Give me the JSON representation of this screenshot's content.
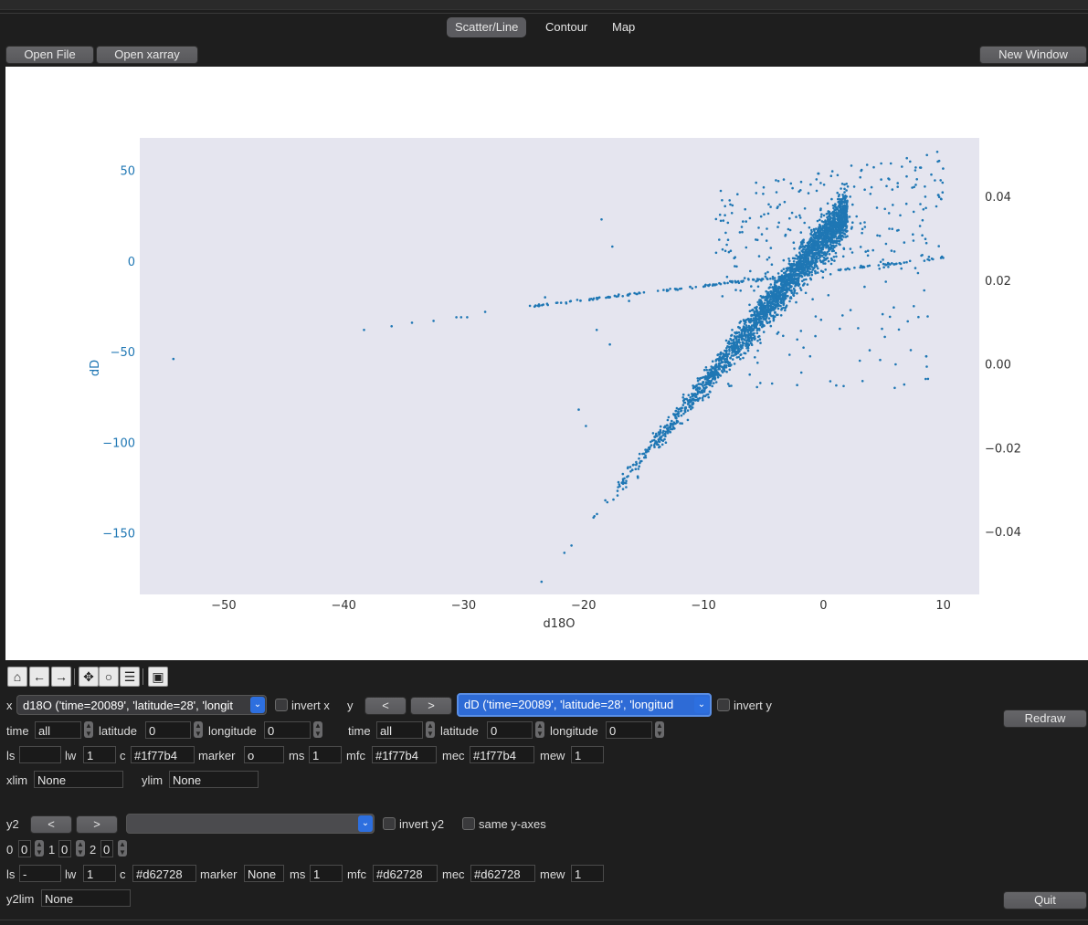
{
  "tabs": [
    {
      "label": "Scatter/Line",
      "active": true
    },
    {
      "label": "Contour",
      "active": false
    },
    {
      "label": "Map",
      "active": false
    }
  ],
  "buttons": {
    "open_file": "Open File",
    "open_xarray": "Open xarray",
    "new_window": "New Window",
    "redraw": "Redraw",
    "quit": "Quit",
    "prev": "<",
    "next": ">"
  },
  "toolbar_icons": [
    "home-icon",
    "back-arrow-icon",
    "forward-arrow-icon",
    "pan-icon",
    "zoom-icon",
    "configure-subplots-icon",
    "save-icon"
  ],
  "chart_data": {
    "type": "scatter",
    "xlabel": "d18O",
    "ylabel": "dD",
    "xlim": [
      -57,
      13
    ],
    "ylim": [
      -184,
      68
    ],
    "y2lim": [
      -0.055,
      0.054
    ],
    "x_ticks": [
      "−50",
      "−40",
      "−30",
      "−20",
      "−10",
      "0",
      "10"
    ],
    "y_ticks": [
      "50",
      "0",
      "−50",
      "−100",
      "−150"
    ],
    "y2_ticks": [
      "0.04",
      "0.02",
      "0.00",
      "−0.02",
      "−0.04"
    ],
    "series": [
      {
        "color": "#1f77b4",
        "marker": "o",
        "size": 1,
        "description_points": [
          [
            -54.2,
            -54
          ],
          [
            -38.3,
            -38
          ],
          [
            -36,
            -36
          ],
          [
            -34.3,
            -34
          ],
          [
            -32.5,
            -33
          ],
          [
            -30.6,
            -31
          ],
          [
            -30.2,
            -31
          ],
          [
            -29.7,
            -31
          ],
          [
            -28.2,
            -28
          ],
          [
            -23.5,
            -177
          ],
          [
            -23.2,
            -20
          ],
          [
            -21.6,
            -161
          ],
          [
            -21,
            -157
          ],
          [
            -20.4,
            -82
          ],
          [
            -19.8,
            -91
          ],
          [
            -18.9,
            -38
          ],
          [
            -18.5,
            23
          ],
          [
            -17.8,
            -46
          ],
          [
            -17.6,
            8
          ],
          [
            -16.2,
            -22
          ]
        ]
      },
      {
        "color": "#1f77b4",
        "marker": "o",
        "size": 1,
        "axis": "y2"
      }
    ],
    "background": "#e5e5ef",
    "grid": false
  },
  "x_controls": {
    "label": "x",
    "variable": "d18O ('time=20089', 'latitude=28', 'longit",
    "invert_label": "invert x",
    "time_label": "time",
    "time_value": "all",
    "latitude_label": "latitude",
    "latitude_value": "0",
    "longitude_label": "longitude",
    "longitude_value": "0"
  },
  "y_controls": {
    "label": "y",
    "variable": "dD ('time=20089', 'latitude=28', 'longitud",
    "invert_label": "invert y",
    "time_label": "time",
    "time_value": "all",
    "latitude_label": "latitude",
    "latitude_value": "0",
    "longitude_label": "longitude",
    "longitude_value": "0"
  },
  "style1": {
    "ls_label": "ls",
    "ls": "",
    "lw_label": "lw",
    "lw": "1",
    "c_label": "c",
    "c": "#1f77b4",
    "marker_label": "marker",
    "marker": "o",
    "ms_label": "ms",
    "ms": "1",
    "mfc_label": "mfc",
    "mfc": "#1f77b4",
    "mec_label": "mec",
    "mec": "#1f77b4",
    "mew_label": "mew",
    "mew": "1"
  },
  "limits": {
    "xlim_label": "xlim",
    "xlim": "None",
    "ylim_label": "ylim",
    "ylim": "None"
  },
  "y2_controls": {
    "label": "y2",
    "variable": "",
    "invert_label": "invert y2",
    "same_label": "same y-axes",
    "dims": [
      {
        "label": "0",
        "value": "0"
      },
      {
        "label": "1",
        "value": "0"
      },
      {
        "label": "2",
        "value": "0"
      }
    ]
  },
  "style2": {
    "ls_label": "ls",
    "ls": "-",
    "lw_label": "lw",
    "lw": "1",
    "c_label": "c",
    "c": "#d62728",
    "marker_label": "marker",
    "marker": "None",
    "ms_label": "ms",
    "ms": "1",
    "mfc_label": "mfc",
    "mfc": "#d62728",
    "mec_label": "mec",
    "mec": "#d62728",
    "mew_label": "mew",
    "mew": "1"
  },
  "y2lim": {
    "label": "y2lim",
    "value": "None"
  }
}
